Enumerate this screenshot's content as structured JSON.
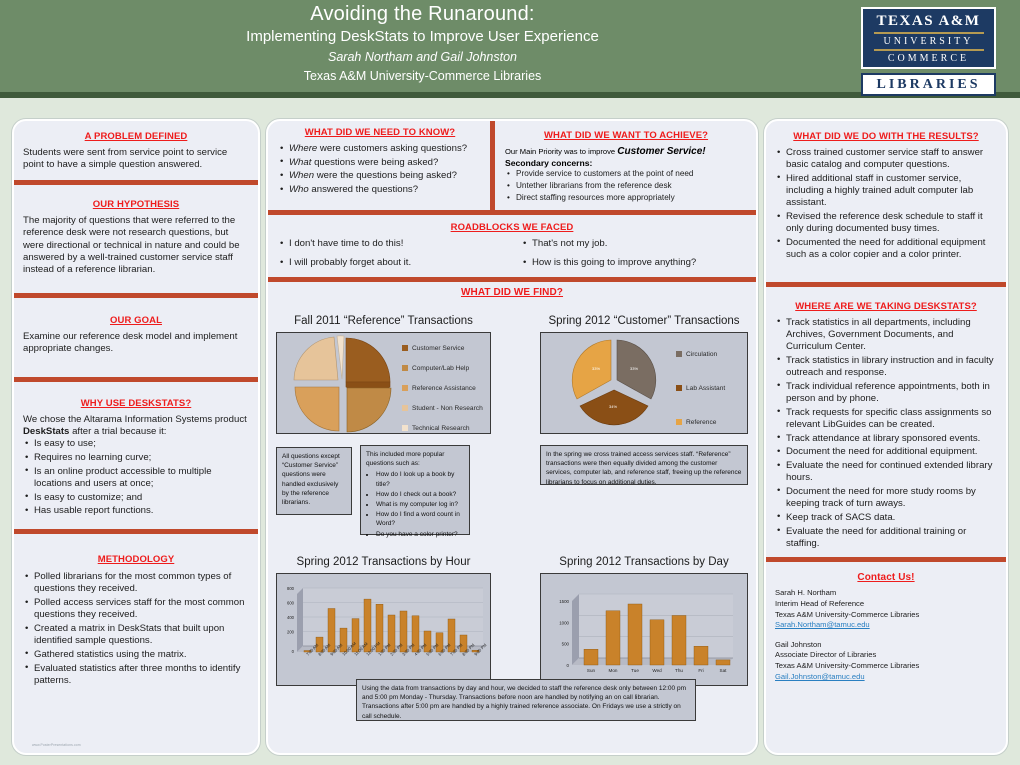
{
  "header": {
    "title": "Avoiding the Runaround:",
    "subtitle": "Implementing DeskStats to Improve User Experience",
    "authors": "Sarah Northam and Gail Johnston",
    "org": "Texas A&M University-Commerce Libraries",
    "logo": {
      "line1": "TEXAS A&M",
      "line2": "UNIVERSITY",
      "line3": "COMMERCE",
      "line4": "LIBRARIES"
    }
  },
  "colors": {
    "header_green": "#6e8c68",
    "divider_red": "#c0492c",
    "heading_red": "#ee1c1c",
    "panel": "#eceef5",
    "chart_bg": "#c3c7d2",
    "bar_orange": "#c07f28",
    "link_blue": "#2a7fc1"
  },
  "col1": {
    "problem": {
      "title": "A PROBLEM DEFINED",
      "text": "Students were sent from service point to service point to have a simple question answered."
    },
    "hypothesis": {
      "title": "OUR HYPOTHESIS",
      "text": "The majority of questions that were referred to the reference desk were not research questions, but were directional or technical in nature and could be answered by a well-trained customer service staff instead of a reference librarian."
    },
    "goal": {
      "title": "OUR GOAL",
      "text": "Examine our reference desk model and implement appropriate changes."
    },
    "why": {
      "title": "WHY USE DESKSTATS?",
      "lead_a": "We chose the Altarama Information Systems product ",
      "lead_b": "DeskStats",
      "lead_c": " after a trial because it:",
      "items": [
        "Is easy to use;",
        "Requires no learning curve;",
        "Is an online product accessible to multiple locations and users at once;",
        "Is easy to customize; and",
        "Has usable report functions."
      ]
    },
    "methodology": {
      "title": "METHODOLOGY",
      "items": [
        "Polled librarians for the most common types of questions they received.",
        "Polled access services staff for the most common questions they received.",
        "Created a matrix in DeskStats that built upon identified sample questions.",
        "Gathered statistics using the matrix.",
        "Evaluated statistics after three months to identify patterns."
      ]
    },
    "watermark": "www.PosterPresentations.com"
  },
  "col2": {
    "need_to_know": {
      "title": "WHAT DID WE NEED TO KNOW?",
      "items": [
        {
          "em": "Where",
          "rest": " were customers asking questions?"
        },
        {
          "em": "What",
          "rest": " questions were being asked?"
        },
        {
          "em": "When",
          "rest": " were the questions being asked?"
        },
        {
          "em": "Who",
          "rest": " answered the questions?"
        }
      ]
    },
    "achieve": {
      "title": "WHAT DID WE WANT TO ACHIEVE?",
      "lead_a": "Our Main Priority was to improve ",
      "lead_b": "Customer Service!",
      "secondary_label": "Secondary concerns:",
      "items": [
        "Provide service to customers at the point of need",
        "Untether librarians from the reference desk",
        "Direct staffing resources more appropriately"
      ]
    },
    "roadblocks": {
      "title": "ROADBLOCKS WE FACED",
      "left": [
        "I don't have time to do this!",
        "I will probably forget about it."
      ],
      "right": [
        "That's not my job.",
        "How is this going to improve anything?"
      ]
    },
    "find": {
      "title": "WHAT DID WE FIND?",
      "note_left": "All questions except “Customer Service” questions were handled exclusively by the reference librarians.",
      "note_mid_lead": "This included more popular questions such as:",
      "note_mid_items": [
        "How do I look up a book by title?",
        "How do I check out a book?",
        "What is my computer log in?",
        "How do I find a word count in Word?",
        "Do you have a color printer?"
      ],
      "note_right": "In the spring we cross trained access services staff. “Reference” transactions were then equally divided among the customer services, computer lab, and reference staff, freeing up the reference librarians to focus on additional duties.",
      "note_bottom": "Using the data from transactions by day and hour, we decided to staff the reference desk only between 12:00 pm and 5:00 pm Monday - Thursday.  Transactions before noon are handled by notifying an on call librarian. Transactions after 5:00 pm are handled by a highly trained reference associate. On Fridays we use a strictly on call schedule."
    }
  },
  "col3": {
    "results": {
      "title": "WHAT DID WE DO WITH THE RESULTS?",
      "items": [
        "Cross trained customer service staff to answer basic catalog and computer questions.",
        "Hired additional staff in customer service, including a highly trained adult computer lab assistant.",
        "Revised the reference desk schedule to staff it only during documented busy times.",
        "Documented the need for additional equipment such as a color copier and a color printer."
      ]
    },
    "future": {
      "title": "WHERE ARE WE TAKING DESKSTATS?",
      "items": [
        "Track statistics in all departments, including Archives, Government Documents, and Curriculum Center.",
        "Track statistics in library instruction and in faculty outreach and response.",
        "Track individual reference appointments, both in person and by phone.",
        "Track requests for specific class assignments so relevant LibGuides can be created.",
        "Track attendance at library sponsored events.",
        "Document the need for additional equipment.",
        "Evaluate the need for continued extended library hours.",
        "Document the need for more study rooms by keeping track of turn aways.",
        "Keep track of SACS data.",
        "Evaluate the need for additional training or staffing."
      ]
    },
    "contact": {
      "title": "Contact Us!",
      "people": [
        {
          "name": "Sarah H. Northam",
          "role": "Interim Head of Reference",
          "org": "Texas A&M University-Commerce Libraries",
          "email": "Sarah.Northam@tamuc.edu"
        },
        {
          "name": "Gail Johnston",
          "role": "Associate Director of Libraries",
          "org": "Texas A&M University-Commerce Libraries",
          "email": "Gail.Johnston@tamuc.edu"
        }
      ]
    }
  },
  "chart_data": [
    {
      "type": "pie",
      "title": "Fall 2011 “Reference” Transactions",
      "legend_position": "right",
      "categories": [
        "Customer Service",
        "Computer/Lab Help",
        "Reference Assistance",
        "Student - Non Research",
        "Technical Research"
      ],
      "values": [
        27,
        26,
        24,
        21,
        2
      ],
      "colors": [
        "#9a5d1f",
        "#c08a46",
        "#d9a05b",
        "#e6c49a",
        "#f2e2cd"
      ]
    },
    {
      "type": "pie",
      "title": "Spring 2012 “Customer” Transactions",
      "legend_position": "right",
      "categories": [
        "Circulation",
        "Lab Assistant",
        "Reference"
      ],
      "values": [
        33,
        34,
        33
      ],
      "colors": [
        "#7a6d62",
        "#8a4f16",
        "#e6a445"
      ]
    },
    {
      "type": "bar",
      "title": "Spring 2012 Transactions by Hour",
      "xlabel": "",
      "ylabel": "",
      "ylim": [
        0,
        800
      ],
      "yticks": [
        0,
        200,
        400,
        600,
        800
      ],
      "grid": true,
      "categories": [
        "7:00 AM",
        "8:00 AM",
        "9:00 AM",
        "10:00 AM",
        "11:00 AM",
        "12:00 PM",
        "1:00 PM",
        "2:00 PM",
        "3:00 PM",
        "4:00 PM",
        "5:00 PM",
        "6:00 PM",
        "7:00 PM",
        "8:00 PM",
        "9:00 PM"
      ],
      "values": [
        20,
        205,
        600,
        330,
        460,
        730,
        660,
        510,
        565,
        500,
        290,
        265,
        455,
        235,
        25
      ]
    },
    {
      "type": "bar",
      "title": "Spring 2012 Transactions by Day",
      "xlabel": "",
      "ylabel": "",
      "ylim": [
        0,
        1750
      ],
      "yticks": [
        0,
        500,
        1000,
        1500
      ],
      "grid": true,
      "categories": [
        "Sun",
        "Mon",
        "Tue",
        "Wed",
        "Thu",
        "Fri",
        "Sat"
      ],
      "values": [
        370,
        1270,
        1430,
        1060,
        1160,
        440,
        120
      ]
    }
  ]
}
